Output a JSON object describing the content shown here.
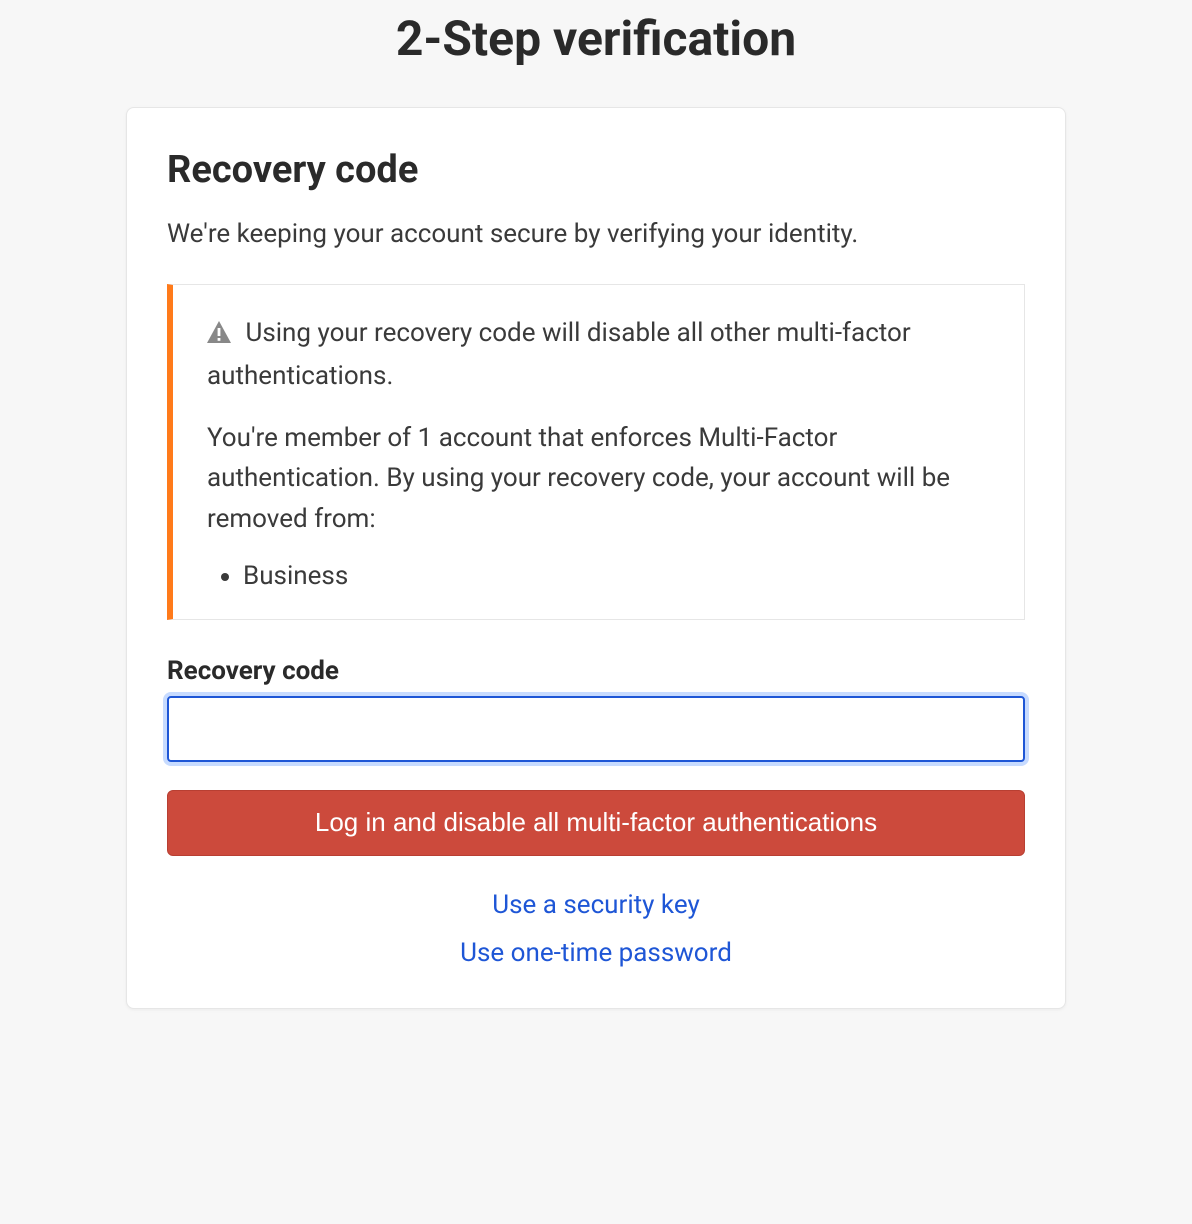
{
  "page": {
    "title": "2-Step verification"
  },
  "card": {
    "heading": "Recovery code",
    "description": "We're keeping your account secure by verifying your identity."
  },
  "alert": {
    "icon_name": "warning-triangle-icon",
    "line1": "Using your recovery code will disable all other multi-factor authentications.",
    "line2": "You're member of 1 account that enforces Multi-Factor authentication. By using your recovery code, your account will be removed from:",
    "accounts": [
      "Business"
    ]
  },
  "form": {
    "field_label": "Recovery code",
    "field_value": "",
    "submit_label": "Log in and disable all multi-factor authentications"
  },
  "alt_links": [
    {
      "label": "Use a security key"
    },
    {
      "label": "Use one-time password"
    }
  ],
  "colors": {
    "alert_accent": "#ff7a1a",
    "button_primary": "#cc4a3c",
    "link": "#1e56d6",
    "focus_ring": "#c7dbff"
  }
}
